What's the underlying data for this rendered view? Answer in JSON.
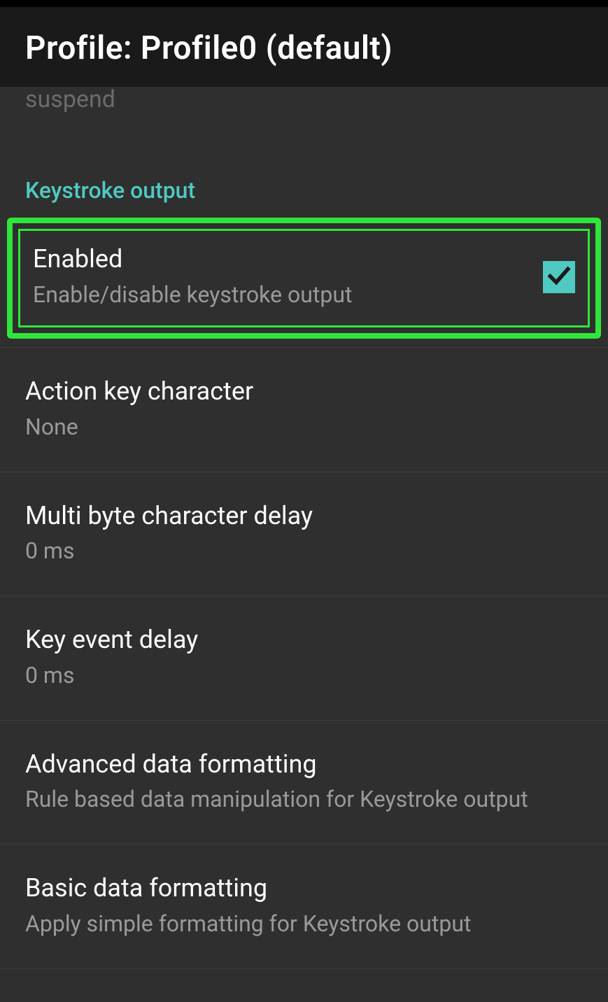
{
  "header": {
    "title": "Profile: Profile0 (default)"
  },
  "cutoff_text": "suspend",
  "section": {
    "label": "Keystroke output"
  },
  "items": {
    "enabled": {
      "title": "Enabled",
      "sub": "Enable/disable keystroke output",
      "checked": true
    },
    "action_key": {
      "title": "Action key character",
      "sub": "None"
    },
    "multibyte": {
      "title": "Multi byte character delay",
      "sub": "0 ms"
    },
    "key_event": {
      "title": "Key event delay",
      "sub": "0 ms"
    },
    "advanced": {
      "title": "Advanced data formatting",
      "sub": "Rule based data manipulation for Keystroke output"
    },
    "basic": {
      "title": "Basic data formatting",
      "sub": "Apply simple formatting for Keystroke output"
    }
  }
}
